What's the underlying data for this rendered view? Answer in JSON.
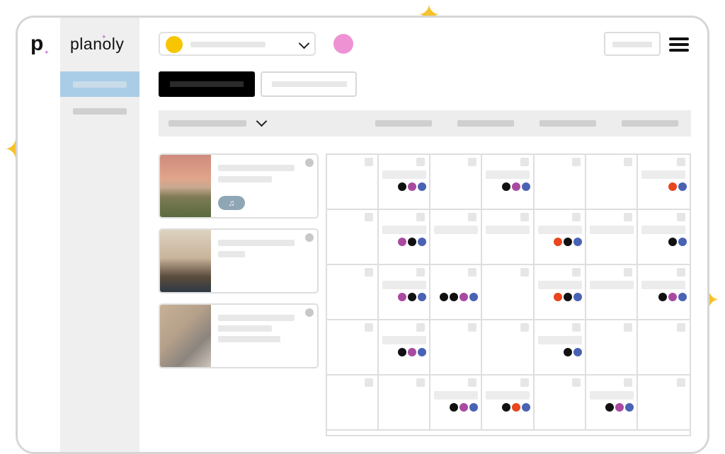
{
  "brand": {
    "name": "planoly",
    "mark": "p",
    "spark": "✦"
  },
  "colors": {
    "black": "#111111",
    "magenta": "#a94aa0",
    "blue": "#4a62b4",
    "orange": "#e9461f",
    "yellow": "#f7c600",
    "pink": "#ee92d3",
    "sidebar_active": "#a9cde6",
    "sparkle": "#f6c12b"
  },
  "icons": {
    "sparkle": "✦",
    "music": "♫"
  },
  "calendar": {
    "cells": [
      {
        "bar": false,
        "dots": []
      },
      {
        "bar": true,
        "dots": [
          "black",
          "magenta",
          "blue"
        ]
      },
      {
        "bar": false,
        "dots": []
      },
      {
        "bar": true,
        "dots": [
          "black",
          "magenta",
          "blue"
        ]
      },
      {
        "bar": false,
        "dots": []
      },
      {
        "bar": false,
        "dots": []
      },
      {
        "bar": true,
        "dots": [
          "orange",
          "blue"
        ]
      },
      {
        "bar": false,
        "dots": []
      },
      {
        "bar": true,
        "dots": [
          "magenta",
          "black",
          "blue"
        ]
      },
      {
        "bar": true,
        "dots": []
      },
      {
        "bar": true,
        "dots": []
      },
      {
        "bar": true,
        "dots": [
          "orange",
          "black",
          "blue"
        ]
      },
      {
        "bar": true,
        "dots": []
      },
      {
        "bar": true,
        "dots": [
          "black",
          "blue"
        ]
      },
      {
        "bar": false,
        "dots": []
      },
      {
        "bar": true,
        "dots": [
          "magenta",
          "black",
          "blue"
        ]
      },
      {
        "bar": false,
        "dots": [
          "black",
          "black",
          "magenta",
          "blue"
        ]
      },
      {
        "bar": false,
        "dots": []
      },
      {
        "bar": true,
        "dots": [
          "orange",
          "black",
          "blue"
        ]
      },
      {
        "bar": true,
        "dots": []
      },
      {
        "bar": true,
        "dots": [
          "black",
          "magenta",
          "blue"
        ]
      },
      {
        "bar": false,
        "dots": []
      },
      {
        "bar": true,
        "dots": [
          "black",
          "magenta",
          "blue"
        ]
      },
      {
        "bar": false,
        "dots": []
      },
      {
        "bar": false,
        "dots": []
      },
      {
        "bar": true,
        "dots": [
          "black",
          "blue"
        ]
      },
      {
        "bar": false,
        "dots": []
      },
      {
        "bar": false,
        "dots": []
      },
      {
        "bar": false,
        "dots": []
      },
      {
        "bar": false,
        "dots": []
      },
      {
        "bar": true,
        "dots": [
          "black",
          "magenta",
          "blue"
        ]
      },
      {
        "bar": true,
        "dots": [
          "black",
          "orange",
          "blue"
        ]
      },
      {
        "bar": false,
        "dots": []
      },
      {
        "bar": true,
        "dots": [
          "black",
          "magenta",
          "blue"
        ]
      },
      {
        "bar": false,
        "dots": []
      }
    ]
  }
}
